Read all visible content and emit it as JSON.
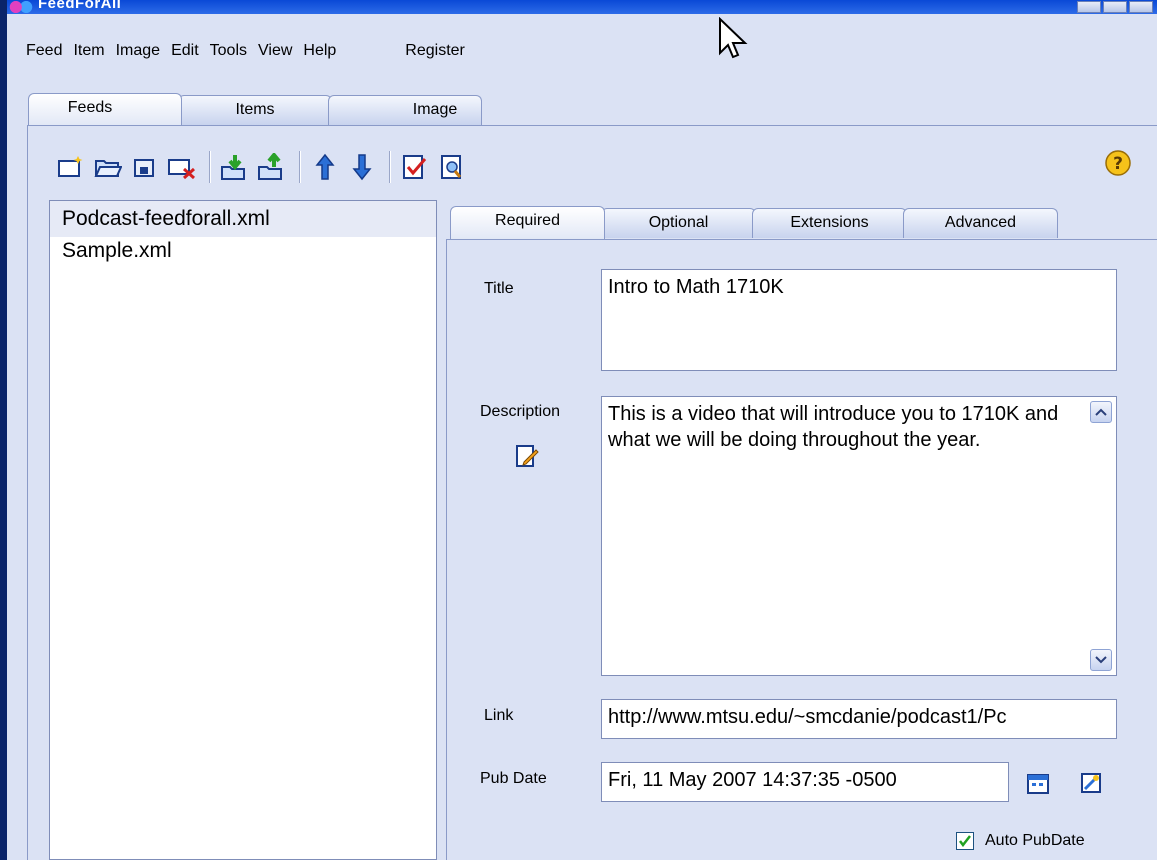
{
  "window": {
    "title": "FeedForAll"
  },
  "menu": {
    "items": [
      "Feed",
      "Item",
      "Image",
      "Edit",
      "Tools",
      "View",
      "Help"
    ],
    "register": "Register"
  },
  "main_tabs": [
    "Feeds",
    "Items",
    "Image"
  ],
  "toolbar": {
    "buttons": [
      "new-feed-icon",
      "open-folder-icon",
      "save-icon",
      "close-feed-icon",
      "import-icon",
      "export-icon",
      "move-up-icon",
      "move-down-icon",
      "validate-icon",
      "preview-icon"
    ],
    "help_icon": "help-icon"
  },
  "files": [
    "Podcast-feedforall.xml",
    "Sample.xml"
  ],
  "sub_tabs": [
    "Required",
    "Optional",
    "Extensions",
    "Advanced"
  ],
  "form": {
    "title_label": "Title",
    "title_value": "Intro to Math 1710K",
    "description_label": "Description",
    "description_value": "This is a video that will introduce you to 1710K and what we will be doing throughout the year.",
    "link_label": "Link",
    "link_value": "http://www.mtsu.edu/~smcdanie/podcast1/Pc",
    "pubdate_label": "Pub Date",
    "pubdate_value": "Fri, 11 May 2007 14:37:35 -0500",
    "auto_pubdate_label": "Auto PubDate",
    "auto_pubdate_checked": true
  },
  "colors": {
    "background": "#dbe2f4",
    "titlebar": "#0a49d6",
    "accent_blue": "#2b6fd6"
  }
}
